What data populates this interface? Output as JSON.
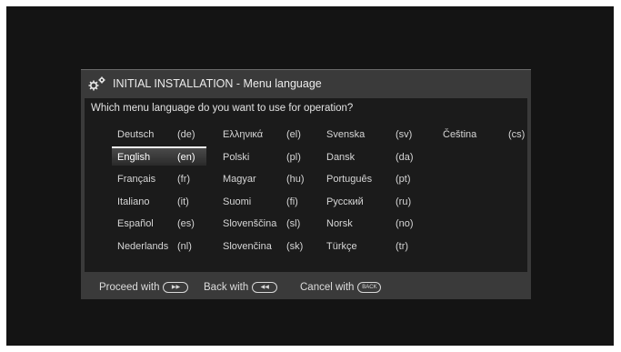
{
  "dialog": {
    "title": "INITIAL INSTALLATION - Menu language",
    "question": "Which menu language do you want to use for operation?"
  },
  "languages": [
    {
      "name": "Deutsch",
      "code": "(de)"
    },
    {
      "name": "English",
      "code": "(en)",
      "selected": true
    },
    {
      "name": "Français",
      "code": "(fr)"
    },
    {
      "name": "Italiano",
      "code": "(it)"
    },
    {
      "name": "Español",
      "code": "(es)"
    },
    {
      "name": "Nederlands",
      "code": "(nl)"
    },
    {
      "name": "Ελληνικά",
      "code": "(el)"
    },
    {
      "name": "Polski",
      "code": "(pl)"
    },
    {
      "name": "Magyar",
      "code": "(hu)"
    },
    {
      "name": "Suomi",
      "code": "(fi)"
    },
    {
      "name": "Slovenščina",
      "code": "(sl)"
    },
    {
      "name": "Slovenčina",
      "code": "(sk)"
    },
    {
      "name": "Svenska",
      "code": "(sv)"
    },
    {
      "name": "Dansk",
      "code": "(da)"
    },
    {
      "name": "Português",
      "code": "(pt)"
    },
    {
      "name": "Русский",
      "code": "(ru)"
    },
    {
      "name": "Norsk",
      "code": "(no)"
    },
    {
      "name": "Türkçe",
      "code": "(tr)"
    },
    {
      "name": "Čeština",
      "code": "(cs)"
    }
  ],
  "footer": {
    "proceed_label": "Proceed with",
    "back_label": "Back with",
    "cancel_label": "Cancel with",
    "back_button_text": "BACK"
  }
}
